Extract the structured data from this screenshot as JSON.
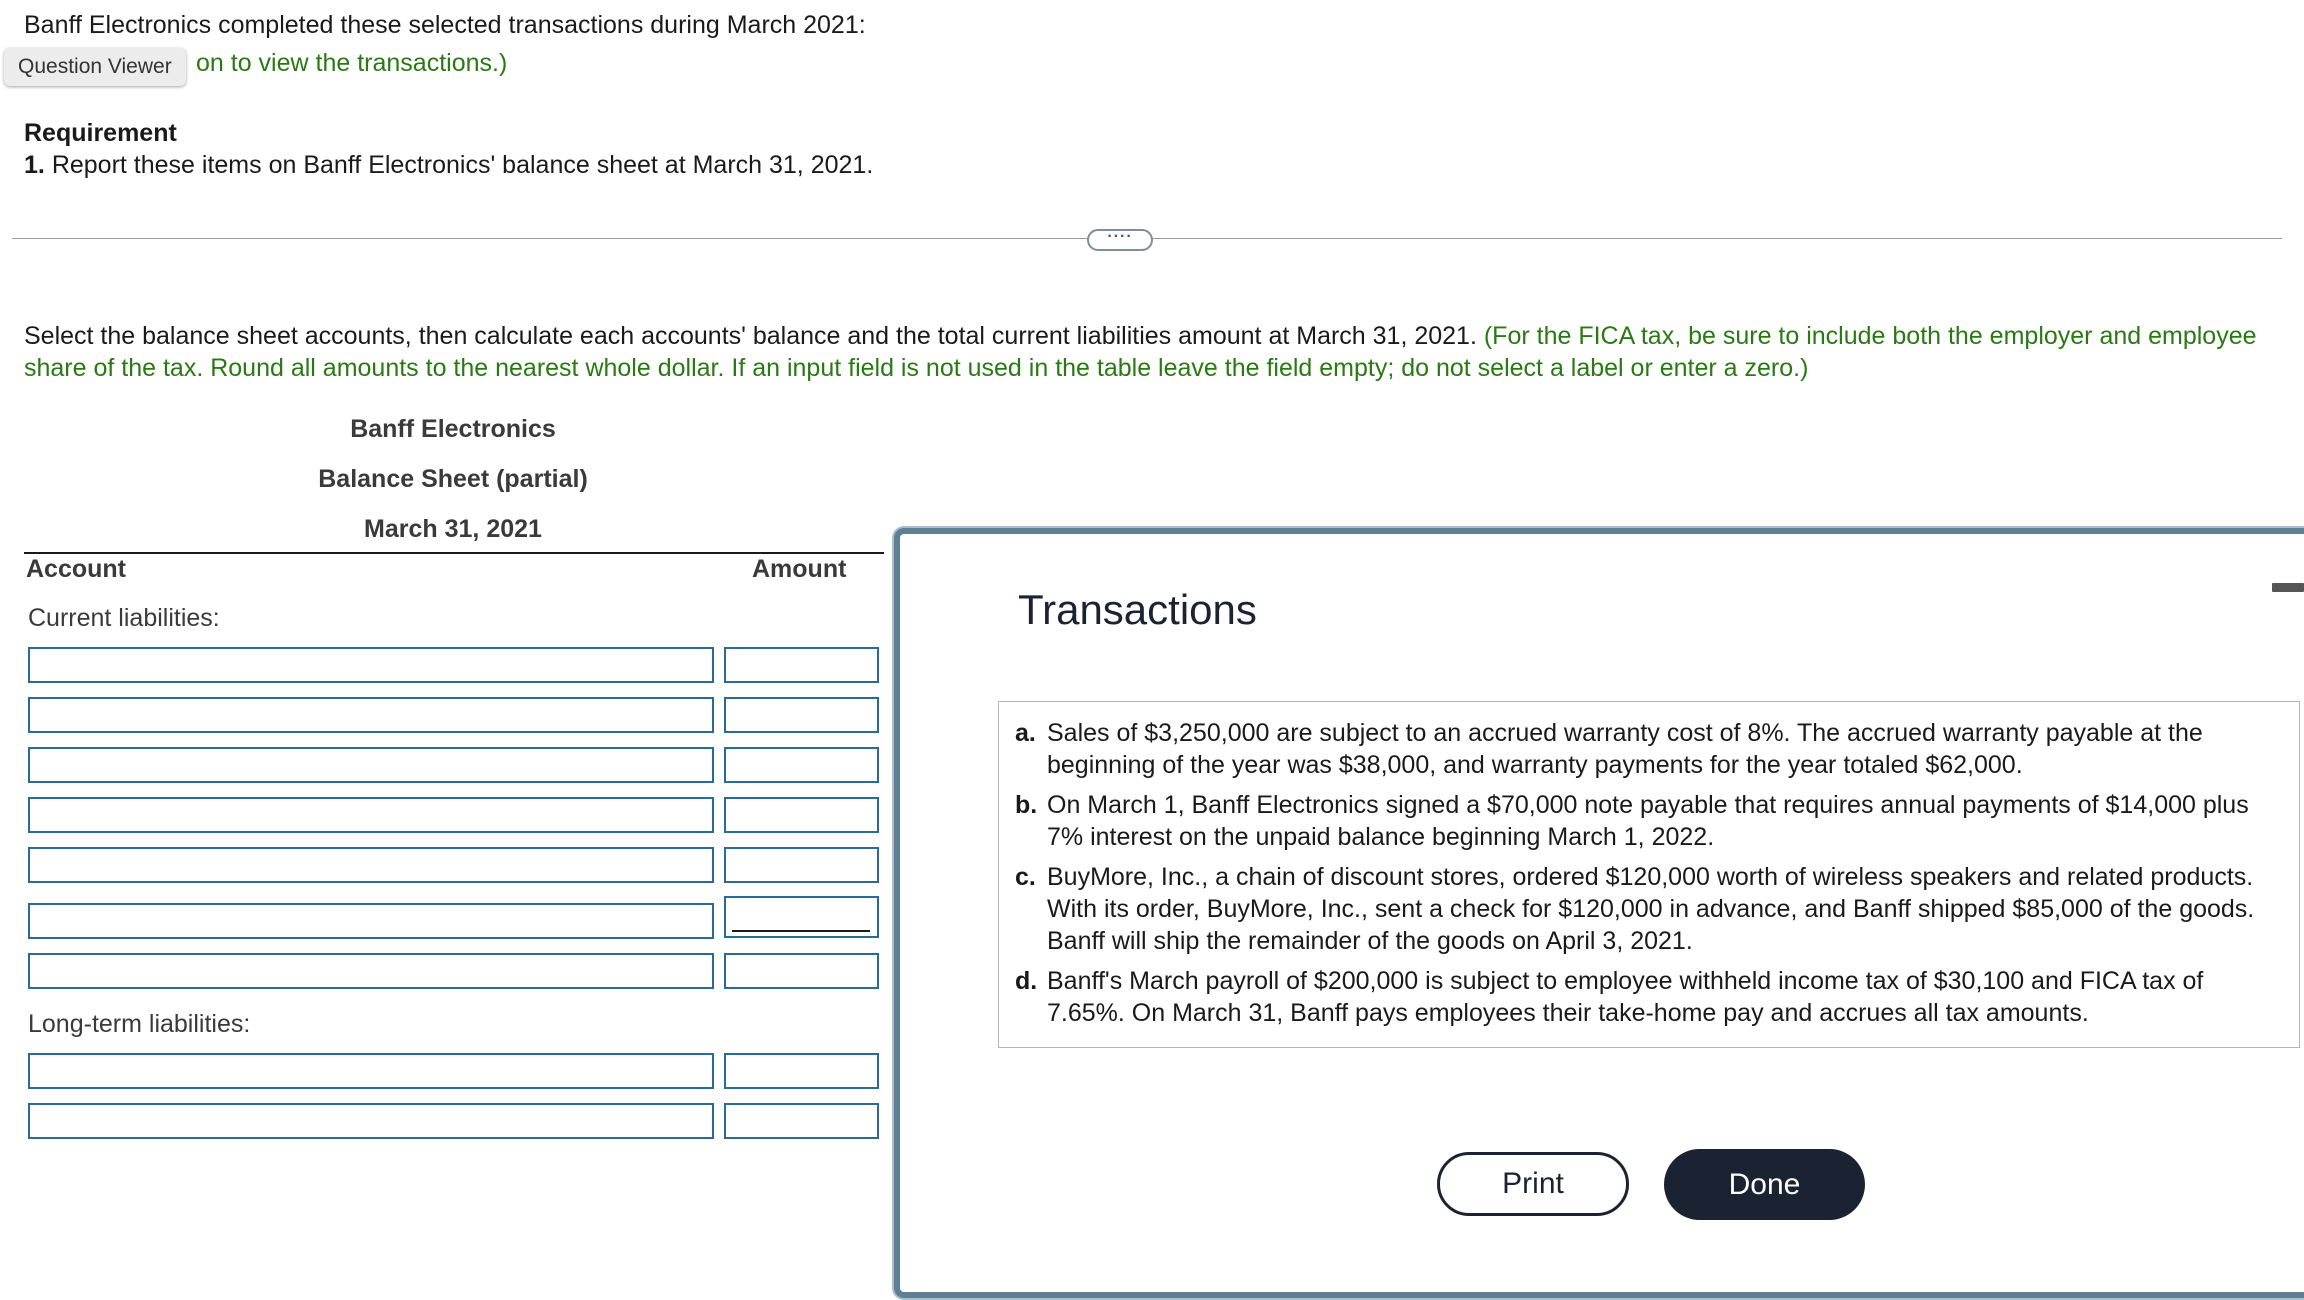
{
  "intro": {
    "text": "Banff Electronics completed these selected transactions during March 2021:",
    "link_text": "on to view the transactions.)"
  },
  "tooltip": {
    "label": "Question Viewer"
  },
  "requirement": {
    "title": "Requirement",
    "number": "1.",
    "text": "Report these items on Banff Electronics' balance sheet at March 31, 2021."
  },
  "expand_button": {
    "label": "····"
  },
  "instructions": {
    "main": "Select the balance sheet accounts, then calculate each accounts' balance and the total current liabilities amount at March 31, 2021.",
    "note": "(For the FICA tax, be sure to include both the employer and employee share of the tax. Round all amounts to the nearest whole dollar. If an input field is not used in the table leave the field empty; do not select a label or enter a zero.)"
  },
  "statement": {
    "company": "Banff Electronics",
    "title": "Balance Sheet (partial)",
    "date": "March 31, 2021",
    "col_account": "Account",
    "col_amount": "Amount",
    "current_label": "Current liabilities:",
    "longterm_label": "Long-term liabilities:",
    "current_rows": [
      {
        "account": "",
        "amount": ""
      },
      {
        "account": "",
        "amount": ""
      },
      {
        "account": "",
        "amount": ""
      },
      {
        "account": "",
        "amount": ""
      },
      {
        "account": "",
        "amount": ""
      },
      {
        "account": "",
        "amount": ""
      },
      {
        "account": "",
        "amount": ""
      }
    ],
    "longterm_rows": [
      {
        "account": "",
        "amount": ""
      },
      {
        "account": "",
        "amount": ""
      }
    ]
  },
  "modal": {
    "title": "Transactions",
    "transactions": [
      {
        "letter": "a.",
        "text": "Sales of $3,250,000 are subject to an accrued warranty cost of 8%. The accrued warranty payable at the beginning of the year was $38,000, and warranty payments for the year totaled $62,000."
      },
      {
        "letter": "b.",
        "text": "On March 1, Banff Electronics signed a $70,000 note payable that requires annual payments of $14,000 plus 7% interest on the unpaid balance beginning March 1, 2022."
      },
      {
        "letter": "c.",
        "text": "BuyMore, Inc., a chain of discount stores, ordered $120,000 worth of wireless speakers and related products. With its order, BuyMore, Inc., sent a check for $120,000 in advance, and Banff shipped $85,000 of the goods. Banff will ship the remainder of the goods on April 3, 2021."
      },
      {
        "letter": "d.",
        "text": "Banff's March payroll of $200,000 is subject to employee withheld income tax of $30,100 and FICA tax of 7.65%. On March 31, Banff pays employees their take-home pay and accrues all tax amounts."
      }
    ],
    "print_label": "Print",
    "done_label": "Done"
  }
}
